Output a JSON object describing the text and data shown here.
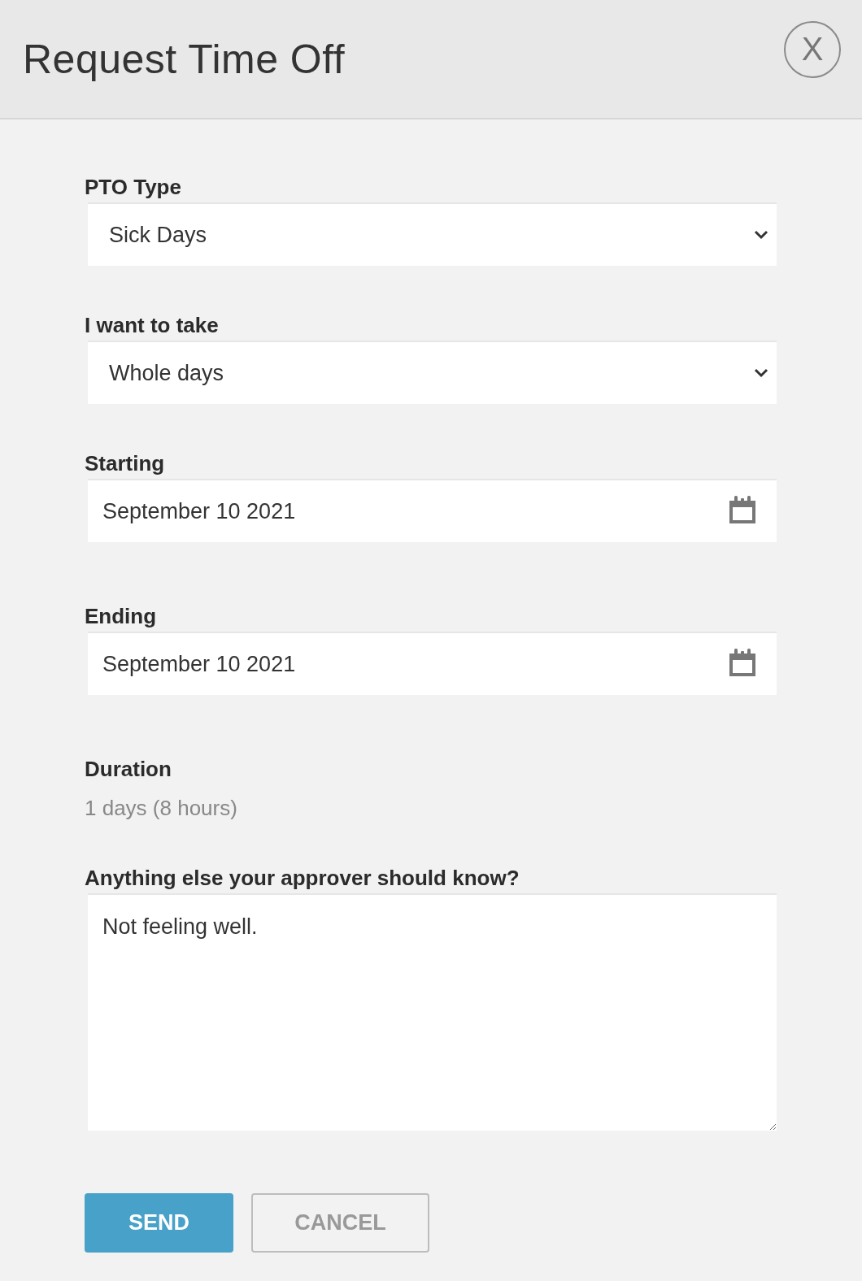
{
  "header": {
    "title": "Request Time Off",
    "close_label": "X"
  },
  "fields": [
    {
      "kind": "select",
      "label": "PTO Type",
      "value": "Sick Days"
    },
    {
      "kind": "select",
      "label": "I want to take",
      "value": "Whole days"
    },
    {
      "kind": "date",
      "label": "Starting",
      "value": "September 10 2021"
    },
    {
      "kind": "date",
      "label": "Ending",
      "value": "September 10 2021"
    },
    {
      "kind": "readout",
      "label": "Duration",
      "value": "1 days (8 hours)"
    },
    {
      "kind": "textarea",
      "label": "Anything else your approver should know?",
      "value": "Not feeling well."
    }
  ],
  "buttons": [
    {
      "kind": "primary",
      "label": "SEND"
    },
    {
      "kind": "secondary",
      "label": "CANCEL"
    }
  ]
}
